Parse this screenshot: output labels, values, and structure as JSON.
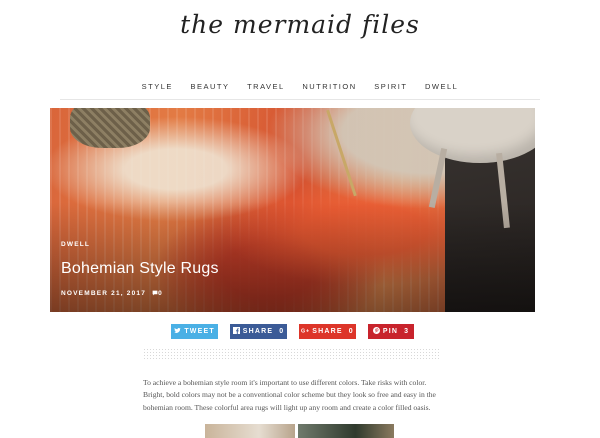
{
  "site": {
    "title": "the mermaid files"
  },
  "nav": {
    "items": [
      "STYLE",
      "BEAUTY",
      "TRAVEL",
      "NUTRITION",
      "SPIRIT",
      "DWELL"
    ]
  },
  "hero": {
    "category": "DWELL",
    "title": "Bohemian Style Rugs",
    "date": "NOVEMBER 21, 2017",
    "comments": "0"
  },
  "share": {
    "tweet": {
      "label": "TWEET",
      "icon": "twitter-icon",
      "color": "#4ab0e5"
    },
    "facebook": {
      "label": "SHARE",
      "count": "0",
      "icon": "facebook-icon",
      "color": "#3b5b97"
    },
    "googleplus": {
      "label": "SHARE",
      "count": "0",
      "icon": "google-plus-icon",
      "color": "#dd3529"
    },
    "pinterest": {
      "label": "PIN",
      "count": "3",
      "icon": "pinterest-icon",
      "color": "#c8232c"
    }
  },
  "article": {
    "intro": "To achieve a bohemian style room it's important to use different colors. Take risks with color. Bright, bold colors may not be a conventional color scheme but they look so free and easy in the bohemian room. These colorful area rugs will light up any room and create a color filled oasis."
  }
}
